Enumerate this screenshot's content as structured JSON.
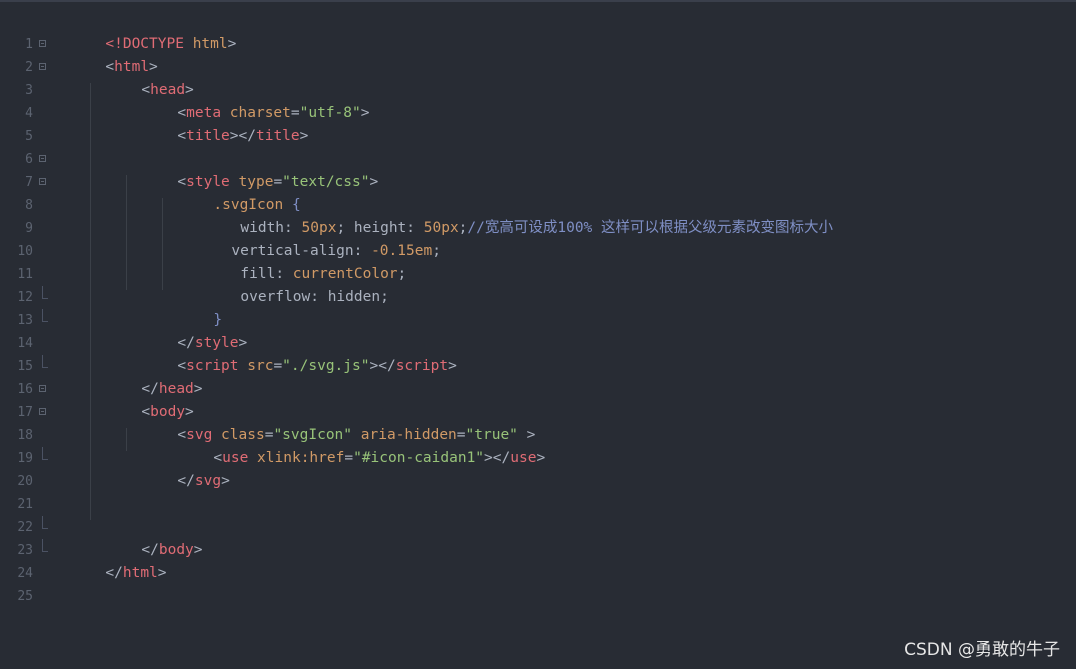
{
  "editor": {
    "line_numbers": [
      "1",
      "2",
      "3",
      "4",
      "5",
      "6",
      "7",
      "8",
      "9",
      "10",
      "11",
      "12",
      "13",
      "14",
      "15",
      "16",
      "17",
      "18",
      "19",
      "20",
      "21",
      "22",
      "23",
      "24",
      "25"
    ],
    "lines": {
      "l1": {
        "a": "<!DOCTYPE",
        "b": " html",
        "c": ">"
      },
      "l2": {
        "a": "<",
        "b": "html",
        "c": ">"
      },
      "l3": {
        "a": "<",
        "b": "head",
        "c": ">"
      },
      "l4": {
        "a": "<",
        "b": "meta",
        "c": " charset",
        "d": "=",
        "e": "\"utf-8\"",
        "f": ">"
      },
      "l5": {
        "a": "<",
        "b": "title",
        "c": "></",
        "d": "title",
        "e": ">"
      },
      "l7": {
        "a": "<",
        "b": "style",
        "c": " type",
        "d": "=",
        "e": "\"text/css\"",
        "f": ">"
      },
      "l8": {
        "a": ".svgIcon",
        "b": " {"
      },
      "l9": {
        "a": "width",
        "b": ": ",
        "c": "50px",
        "d": "; height",
        "e": ": ",
        "f": "50px",
        "g": ";",
        "h": "//宽高可设成100% 这样可以根据父级元素改变图标大小"
      },
      "l10": {
        "a": "vertical-align",
        "b": ": ",
        "c": "-0.15em",
        "d": ";"
      },
      "l11": {
        "a": "fill",
        "b": ": ",
        "c": "currentColor",
        "d": ";"
      },
      "l12": {
        "a": "overflow",
        "b": ": ",
        "c": "hidden",
        "d": ";"
      },
      "l13": {
        "a": "}"
      },
      "l14": {
        "a": "</",
        "b": "style",
        "c": ">"
      },
      "l15": {
        "a": "<",
        "b": "script",
        "c": " src",
        "d": "=",
        "e": "\"./svg.js\"",
        "f": "></",
        "g": "script",
        "h": ">"
      },
      "l16": {
        "a": "</",
        "b": "head",
        "c": ">"
      },
      "l17": {
        "a": "<",
        "b": "body",
        "c": ">"
      },
      "l18": {
        "a": "<",
        "b": "svg",
        "c": " class",
        "d": "=",
        "e": "\"svgIcon\"",
        "f": " aria-hidden",
        "g": "=",
        "h": "\"true\"",
        "i": " >"
      },
      "l19": {
        "a": "<",
        "b": "use",
        "c": " xlink:href",
        "d": "=",
        "e": "\"#icon-caidan1\"",
        "f": "></",
        "g": "use",
        "h": ">"
      },
      "l20": {
        "a": "</",
        "b": "svg",
        "c": ">"
      },
      "l23": {
        "a": "</",
        "b": "body",
        "c": ">"
      },
      "l24": {
        "a": "</",
        "b": "html",
        "c": ">"
      }
    }
  },
  "watermark": "CSDN @勇敢的牛子"
}
